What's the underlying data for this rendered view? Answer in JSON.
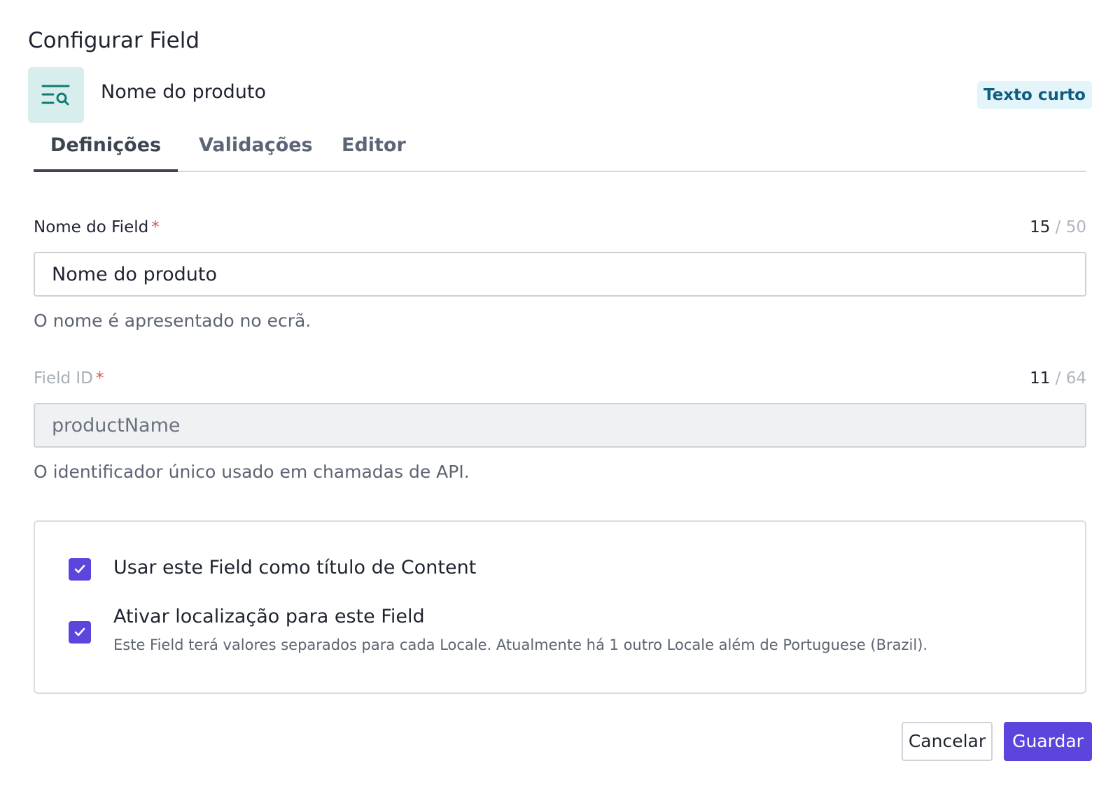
{
  "dialog": {
    "title": "Configurar Field"
  },
  "field_header": {
    "icon": "text-search-icon",
    "name": "Nome do produto",
    "type_badge": "Texto curto"
  },
  "tabs": [
    {
      "label": "Definições",
      "active": true
    },
    {
      "label": "Validações",
      "active": false
    },
    {
      "label": "Editor",
      "active": false
    }
  ],
  "form": {
    "name_field": {
      "label": "Nome do Field",
      "required_mark": "*",
      "count": "15",
      "separator": "/",
      "max": "50",
      "value": "Nome do produto",
      "help": "O nome é apresentado no ecrã."
    },
    "id_field": {
      "label": "Field ID",
      "required_mark": "*",
      "count": "11",
      "separator": "/",
      "max": "64",
      "value": "productName",
      "disabled": true,
      "help": "O identificador único usado em chamadas de API."
    }
  },
  "options": {
    "title_option": {
      "label": "Usar este Field como título de Content",
      "checked": true
    },
    "localization_option": {
      "label": "Ativar localização para este Field",
      "description": "Este Field terá valores separados para cada Locale. Atualmente há 1 outro Locale além de Portuguese (Brazil).",
      "checked": true
    }
  },
  "footer": {
    "cancel_label": "Cancelar",
    "save_label": "Guardar"
  },
  "colors": {
    "accent": "#5b45dd",
    "icon_teal": "#0e7c72",
    "badge_bg": "#e3f5fb",
    "badge_text": "#0f5e80",
    "required": "#d45a5a"
  }
}
